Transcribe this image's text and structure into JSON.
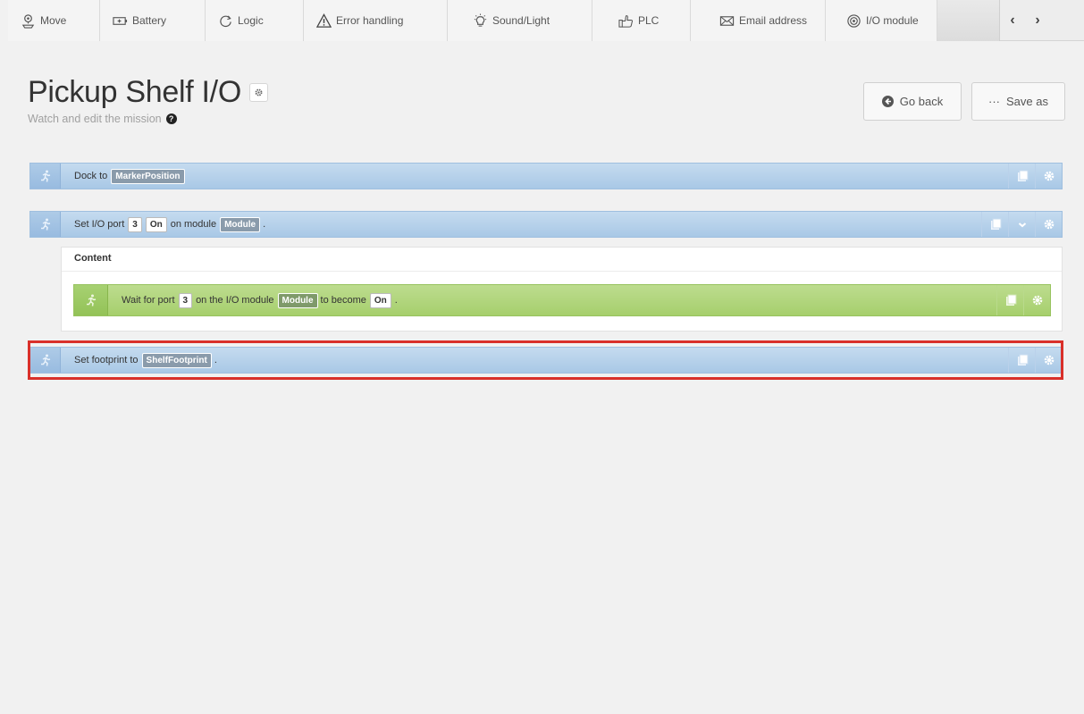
{
  "toolbar": {
    "tabs": [
      {
        "label": "Move",
        "icon": "location-pin-icon"
      },
      {
        "label": "Battery",
        "icon": "battery-icon"
      },
      {
        "label": "Logic",
        "icon": "loop-icon"
      },
      {
        "label": "Error handling",
        "icon": "warning-icon"
      },
      {
        "label": "Sound/Light",
        "icon": "bulb-icon"
      },
      {
        "label": "PLC",
        "icon": "thumbs-up-icon"
      },
      {
        "label": "Email address",
        "icon": "envelope-icon"
      },
      {
        "label": "I/O module",
        "icon": "io-module-icon"
      }
    ],
    "prev_label": "‹",
    "next_label": "›"
  },
  "header": {
    "title": "Pickup Shelf I/O",
    "subtitle": "Watch and edit the mission",
    "help_glyph": "?",
    "go_back_label": "Go back",
    "save_as_label": "Save as",
    "save_as_glyph": "···"
  },
  "mission": {
    "row1": {
      "prefix": "Dock to",
      "marker": "MarkerPosition"
    },
    "row2": {
      "w1": "Set I/O port",
      "port": "3",
      "state": "On",
      "w2": "on module",
      "module": "Module",
      "end": "."
    },
    "content_label": "Content",
    "row3": {
      "w1": "Wait for port",
      "port": "3",
      "w2": "on the I/O module",
      "module": "Module",
      "w3": "to become",
      "state": "On",
      "end": "."
    },
    "row4": {
      "prefix": "Set footprint to",
      "footprint": "ShelfFootprint",
      "end": "."
    }
  },
  "colors": {
    "row_blue": "#b7d2ec",
    "row_green": "#b2d67f",
    "highlight": "#d9302a"
  }
}
